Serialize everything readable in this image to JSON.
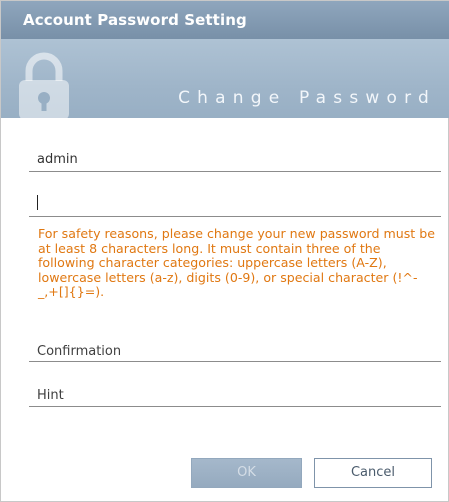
{
  "window": {
    "title": "Account Password Setting"
  },
  "banner": {
    "heading": "Change Password",
    "icon": "lock-icon"
  },
  "form": {
    "username_value": "admin",
    "password_value": "",
    "confirmation_placeholder": "Confirmation",
    "hint_placeholder": "Hint",
    "notice": "For safety reasons, please change your new password must be at least 8 characters long. It must contain three of the following character categories: uppercase letters (A-Z), lowercase letters (a-z), digits (0-9), or special character (!^-_,+[]{}=)."
  },
  "buttons": {
    "ok_label": "OK",
    "cancel_label": "Cancel"
  },
  "colors": {
    "titlebar": "#7f97ae",
    "banner": "#a8bdd0",
    "notice_text": "#e07812",
    "button_ok_disabled": "#9db1c5"
  }
}
